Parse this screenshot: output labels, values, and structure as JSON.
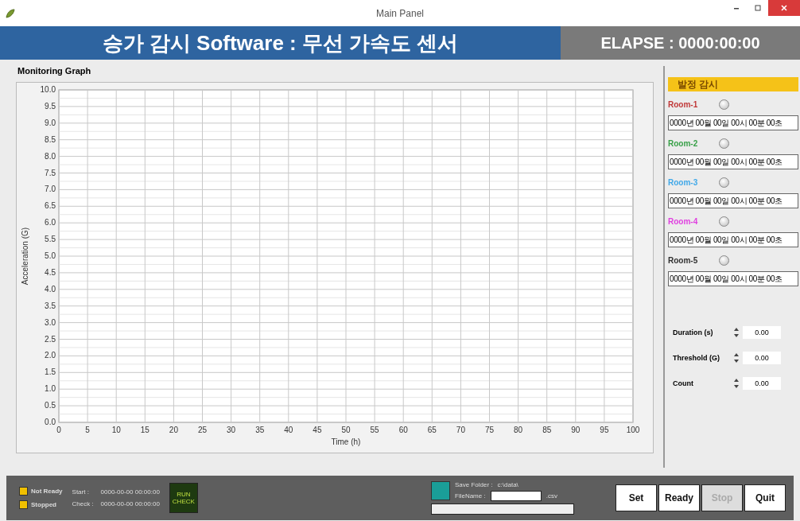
{
  "window": {
    "title": "Main Panel"
  },
  "banner": {
    "title": "승가 감시 Software : 무선 가속도 센서",
    "elapse": "ELAPSE : 0000:00:00"
  },
  "graph": {
    "title": "Monitoring Graph",
    "chart_data": {
      "type": "line",
      "grid": true,
      "xlabel": "Time (h)",
      "ylabel": "Acceleration (G)",
      "xlim": [
        0,
        100
      ],
      "ylim": [
        0,
        10
      ],
      "xticks": [
        0,
        5,
        10,
        15,
        20,
        25,
        30,
        35,
        40,
        45,
        50,
        55,
        60,
        65,
        70,
        75,
        80,
        85,
        90,
        95,
        100
      ],
      "yticks": [
        {
          "value": 0,
          "label": "0.0"
        },
        {
          "value": 0.5,
          "label": "0.5"
        },
        {
          "value": 1,
          "label": "1.0"
        },
        {
          "value": 1.5,
          "label": "1.5"
        },
        {
          "value": 2,
          "label": "2.0"
        },
        {
          "value": 2.5,
          "label": "2.5"
        },
        {
          "value": 3,
          "label": "3.0"
        },
        {
          "value": 3.5,
          "label": "3.5"
        },
        {
          "value": 4,
          "label": "4.0"
        },
        {
          "value": 4.5,
          "label": "4.5"
        },
        {
          "value": 5,
          "label": "5.0"
        },
        {
          "value": 5.5,
          "label": "5.5"
        },
        {
          "value": 6,
          "label": "6.0"
        },
        {
          "value": 6.5,
          "label": "6.5"
        },
        {
          "value": 7,
          "label": "7.0"
        },
        {
          "value": 7.5,
          "label": "7.5"
        },
        {
          "value": 8,
          "label": "8.0"
        },
        {
          "value": 8.5,
          "label": "8.5"
        },
        {
          "value": 9,
          "label": "9.0"
        },
        {
          "value": 9.5,
          "label": "9.5"
        },
        {
          "value": 10,
          "label": "10.0"
        }
      ]
    }
  },
  "monitor": {
    "title": "발정 감시",
    "rooms": [
      {
        "name": "Room-1",
        "color": "#c03838",
        "lit": false,
        "time": "0000년 00월 00일  00시 00분 00초"
      },
      {
        "name": "Room-2",
        "color": "#38a048",
        "lit": false,
        "time": "0000년 00월 00일  00시 00분 00초"
      },
      {
        "name": "Room-3",
        "color": "#40a8e8",
        "lit": false,
        "time": "0000년 00월 00일  00시 00분 00초"
      },
      {
        "name": "Room-4",
        "color": "#e040e0",
        "lit": false,
        "time": "0000년 00월 00일  00시 00분 00초"
      },
      {
        "name": "Room-5",
        "color": "#303030",
        "lit": false,
        "time": "0000년 00월 00일  00시 00분 00초"
      }
    ],
    "params": [
      {
        "label": "Duration (s)",
        "value": "0.00"
      },
      {
        "label": "Threshold (G)",
        "value": "0.00"
      },
      {
        "label": "Count",
        "value": "0.00"
      }
    ]
  },
  "status_bar": {
    "indicators": [
      {
        "label": "Not Ready",
        "color": "#f0c000"
      },
      {
        "label": "Stopped",
        "color": "#f0c000"
      }
    ],
    "times": [
      {
        "label": "Start :",
        "value": "0000-00-00  00:00:00"
      },
      {
        "label": "Check :",
        "value": "0000-00-00  00:00:00"
      }
    ],
    "run_check": "RUN CHECK",
    "save_folder_label": "Save Folder :",
    "save_folder": "c:\\data\\",
    "filename_label": "FileName :",
    "extension": ".csv",
    "buttons": [
      {
        "label": "Set",
        "disabled": false
      },
      {
        "label": "Ready",
        "disabled": false
      },
      {
        "label": "Stop",
        "disabled": true
      },
      {
        "label": "Quit",
        "disabled": false
      }
    ]
  }
}
